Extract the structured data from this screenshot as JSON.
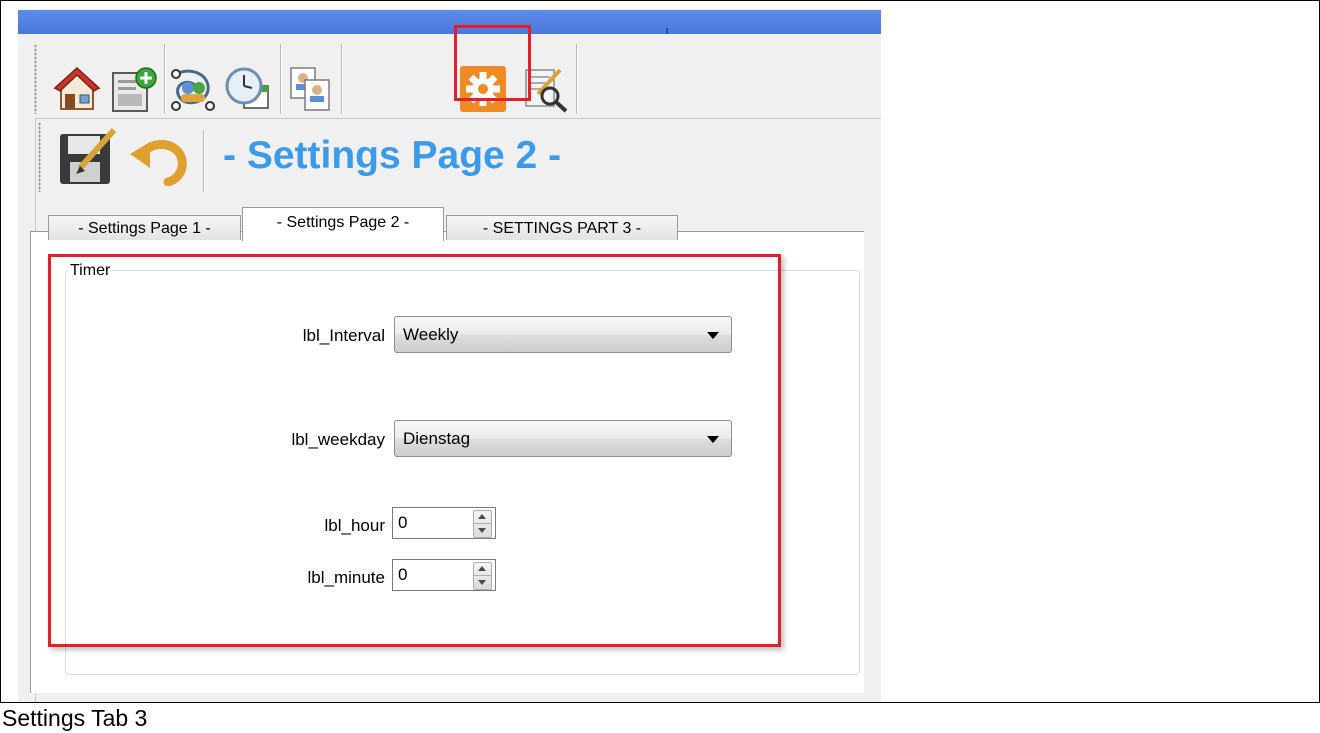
{
  "toolbar": {
    "buttons": [
      {
        "name": "home-icon"
      },
      {
        "name": "new-report-icon"
      },
      {
        "name": "network-users-icon"
      },
      {
        "name": "clock-calendar-icon"
      },
      {
        "name": "user-documents-icon"
      },
      {
        "name": "settings-gear-icon"
      },
      {
        "name": "edit-search-icon"
      }
    ],
    "active_button": "settings-gear-icon"
  },
  "secondary_toolbar": {
    "save_icon": "save-icon",
    "undo_icon": "undo-icon"
  },
  "page": {
    "heading": "- Settings Page 2 -"
  },
  "tabs": [
    {
      "label": "- Settings Page 1 -",
      "active": false
    },
    {
      "label": "- Settings Page 2 -",
      "active": true
    },
    {
      "label": "- SETTINGS PART 3 -",
      "active": false
    }
  ],
  "timer_group": {
    "legend": "Timer",
    "interval": {
      "label": "lbl_Interval",
      "value": "Weekly"
    },
    "weekday": {
      "label": "lbl_weekday",
      "value": "Dienstag"
    },
    "hour": {
      "label": "lbl_hour",
      "value": "0"
    },
    "minute": {
      "label": "lbl_minute",
      "value": "0"
    }
  },
  "caption": "Settings Tab 3",
  "colors": {
    "highlight": "#e0202a",
    "heading": "#3b9ae9",
    "titlebar": "#4a78dc",
    "settings_orange": "#f08a24"
  }
}
